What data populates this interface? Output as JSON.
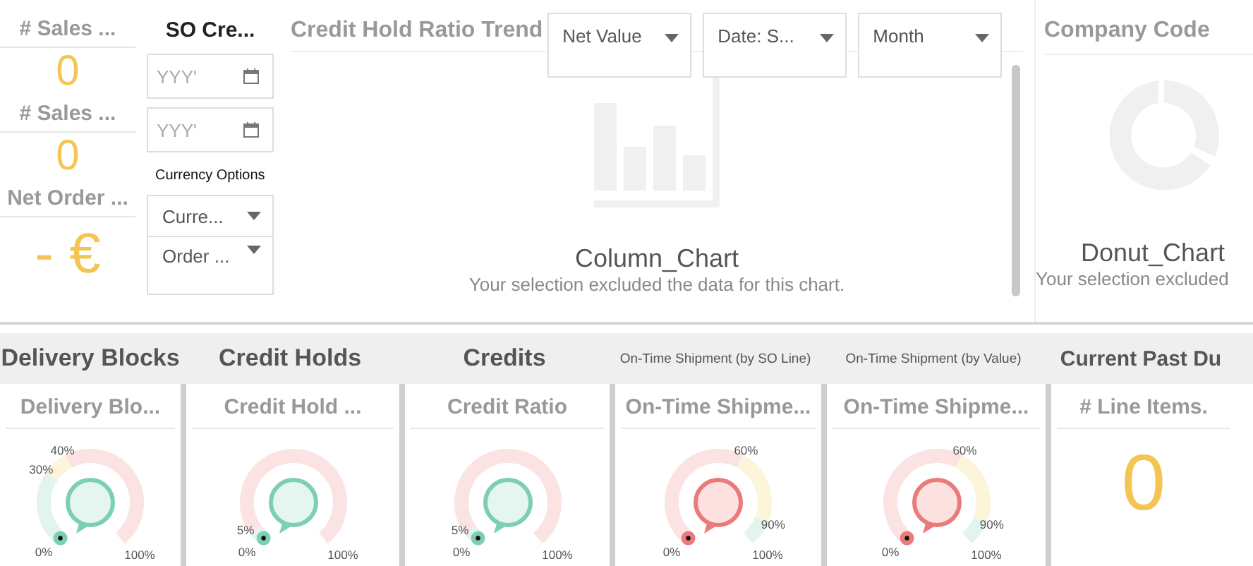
{
  "kpis": [
    {
      "title": "# Sales ...",
      "value": "0"
    },
    {
      "title": "# Sales ...",
      "value": "0"
    },
    {
      "title": "Net Order ...",
      "value": "- €"
    }
  ],
  "filters": {
    "title": "SO Cre...",
    "date_fields": [
      {
        "placeholder": "YYY'"
      },
      {
        "placeholder": "YYY'"
      }
    ],
    "currency_label": "Currency Options",
    "dropdowns": [
      {
        "value": "Curre..."
      },
      {
        "value": "Order ..."
      }
    ]
  },
  "trend": {
    "title": "Credit Hold Ratio Trend",
    "dropdowns": [
      "Net Value",
      "Date: S...",
      "Month"
    ],
    "placeholder": {
      "kind": "column",
      "name": "Column_Chart",
      "message": "Your selection excluded the data for this chart."
    }
  },
  "company": {
    "title": "Company Code",
    "placeholder": {
      "kind": "donut",
      "name": "Donut_Chart",
      "message": "Your selection excluded"
    }
  },
  "groups": [
    {
      "title": "Delivery Blocks",
      "kind": "large",
      "card": {
        "kind": "gauge",
        "title": "Delivery Blo...",
        "gauge": {
          "kind": "blocks",
          "labels": [
            "0%",
            "30%",
            "40%",
            "100%"
          ]
        }
      }
    },
    {
      "title": "Credit Holds",
      "kind": "large",
      "card": {
        "kind": "gauge",
        "title": "Credit Hold ...",
        "gauge": {
          "kind": "ratio",
          "labels": [
            "5%",
            "0%",
            "100%"
          ]
        }
      }
    },
    {
      "title": "Credits",
      "kind": "large",
      "card": {
        "kind": "gauge",
        "title": "Credit Ratio",
        "gauge": {
          "kind": "ratio",
          "labels": [
            "5%",
            "0%",
            "100%"
          ]
        }
      }
    },
    {
      "title": "On-Time Shipment (by SO Line)",
      "kind": "small",
      "card": {
        "kind": "gauge",
        "title": "On-Time Shipme...",
        "gauge": {
          "kind": "shipment",
          "labels": [
            "0%",
            "60%",
            "90%",
            "100%"
          ]
        }
      }
    },
    {
      "title": "On-Time Shipment (by Value)",
      "kind": "small",
      "card": {
        "kind": "gauge",
        "title": "On-Time Shipme...",
        "gauge": {
          "kind": "shipment",
          "labels": [
            "0%",
            "60%",
            "90%",
            "100%"
          ]
        }
      }
    },
    {
      "title": "Current Past Du",
      "kind": "medium",
      "card": {
        "kind": "kpi",
        "title": "# Line Items.",
        "value": "0"
      }
    }
  ]
}
